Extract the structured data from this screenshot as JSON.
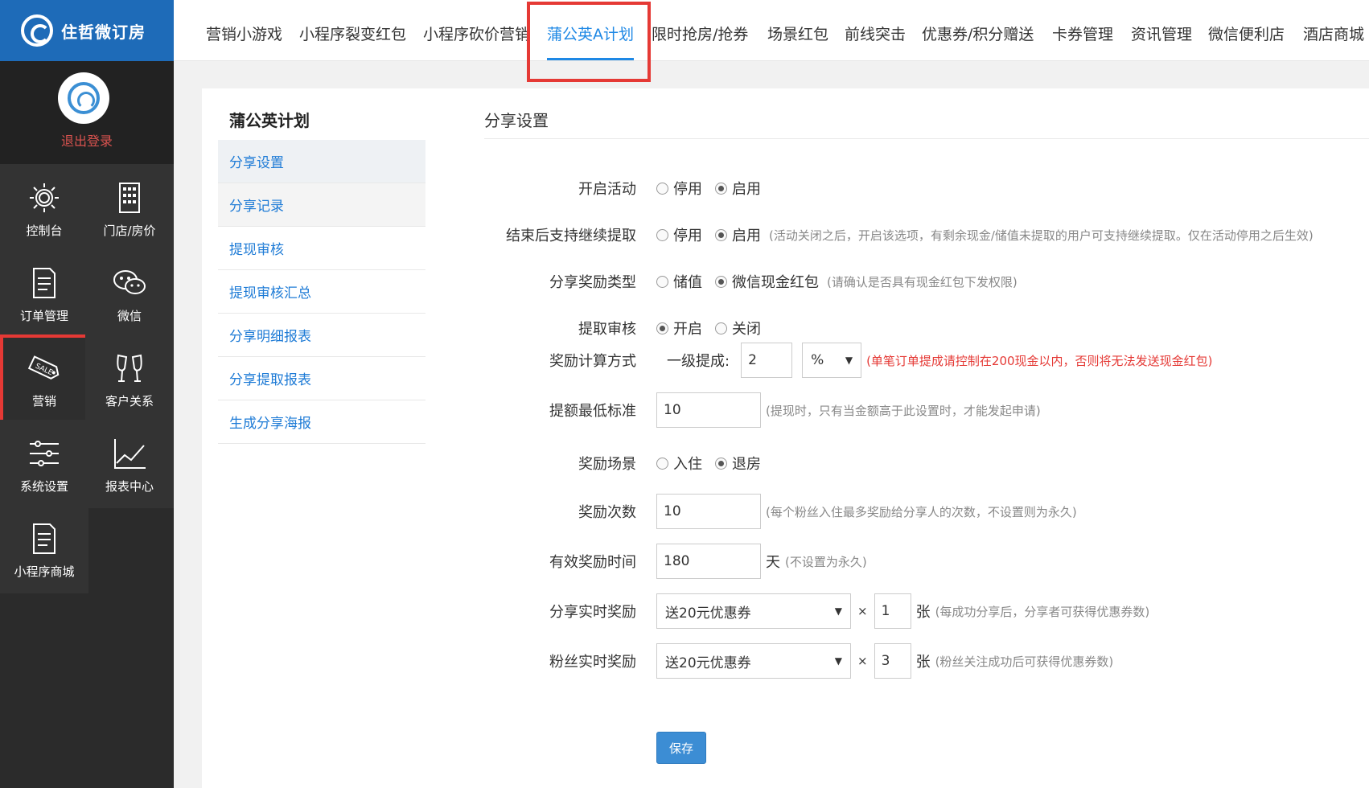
{
  "brand": {
    "name": "住哲微订房"
  },
  "profile": {
    "logout": "退出登录"
  },
  "sidebar": {
    "items": [
      {
        "label": "控制台",
        "icon": "sun-gear-icon"
      },
      {
        "label": "门店/房价",
        "icon": "building-icon"
      },
      {
        "label": "订单管理",
        "icon": "document-icon"
      },
      {
        "label": "微信",
        "icon": "wechat-icon"
      },
      {
        "label": "营销",
        "icon": "sale-tag-icon",
        "active": true
      },
      {
        "label": "客户关系",
        "icon": "wine-glasses-icon"
      },
      {
        "label": "系统设置",
        "icon": "sliders-icon"
      },
      {
        "label": "报表中心",
        "icon": "line-chart-icon"
      },
      {
        "label": "小程序商城",
        "icon": "document-icon"
      }
    ]
  },
  "topnav": {
    "tabs": [
      "营销小游戏",
      "小程序裂变红包",
      "小程序砍价营销",
      "蒲公英A计划",
      "限时抢房/抢券",
      "场景红包",
      "前线突击",
      "优惠券/积分赠送",
      "卡券管理",
      "资讯管理",
      "微信便利店",
      "酒店商城"
    ],
    "active": "蒲公英A计划"
  },
  "submenu": {
    "title": "蒲公英计划",
    "items": [
      "分享设置",
      "分享记录",
      "提现审核",
      "提现审核汇总",
      "分享明细报表",
      "分享提取报表",
      "生成分享海报"
    ]
  },
  "form": {
    "section_title": "分享设置",
    "activity": {
      "label": "开启活动",
      "opt1": "停用",
      "opt2": "启用",
      "selected": "启用"
    },
    "continue_withdraw": {
      "label": "结束后支持继续提取",
      "opt1": "停用",
      "opt2": "启用",
      "selected": "启用",
      "hint": "(活动关闭之后，开启该选项，有剩余现金/储值未提取的用户可支持继续提取。仅在活动停用之后生效)"
    },
    "reward_type": {
      "label": "分享奖励类型",
      "opt1": "储值",
      "opt2": "微信现金红包",
      "selected": "微信现金红包",
      "hint": "(请确认是否具有现金红包下发权限)"
    },
    "withdraw_review": {
      "label": "提取审核",
      "opt1": "开启",
      "opt2": "关闭",
      "selected": "开启"
    },
    "calc_method": {
      "label": "奖励计算方式",
      "prefix": "一级提成:",
      "value": "2",
      "unit": "%",
      "hint": "(单笔订单提成请控制在200现金以内，否则将无法发送现金红包)"
    },
    "min_amount": {
      "label": "提额最低标准",
      "value": "10",
      "hint": "(提现时，只有当金额高于此设置时，才能发起申请)"
    },
    "scene": {
      "label": "奖励场景",
      "opt1": "入住",
      "opt2": "退房",
      "selected": "退房"
    },
    "count": {
      "label": "奖励次数",
      "value": "10",
      "hint": "(每个粉丝入住最多奖励给分享人的次数，不设置则为永久)"
    },
    "valid_time": {
      "label": "有效奖励时间",
      "value": "180",
      "unit": "天",
      "hint": "(不设置为永久)"
    },
    "share_reward": {
      "label": "分享实时奖励",
      "coupon": "送20元优惠券",
      "times": "×",
      "qty": "1",
      "unit": "张",
      "hint": "(每成功分享后，分享者可获得优惠券数)"
    },
    "fan_reward": {
      "label": "粉丝实时奖励",
      "coupon": "送20元优惠券",
      "times": "×",
      "qty": "3",
      "unit": "张",
      "hint": "(粉丝关注成功后可获得优惠券数)"
    },
    "save": "保存"
  }
}
